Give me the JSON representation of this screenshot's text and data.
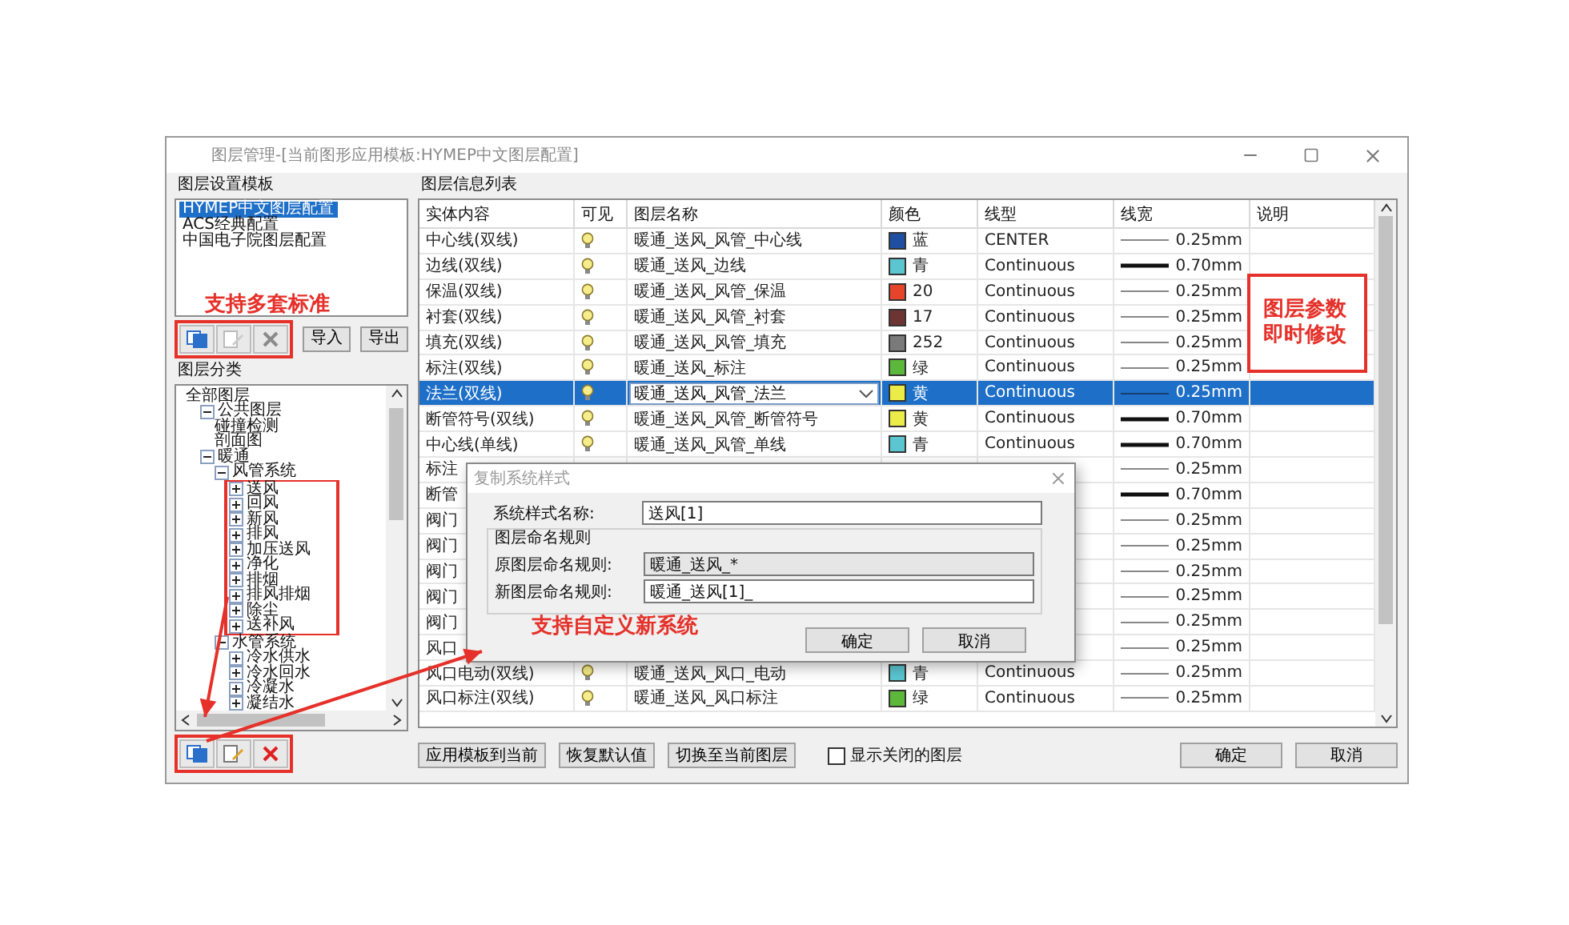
{
  "window": {
    "title": "图层管理-[当前图形应用模板:HYMEP中文图层配置]"
  },
  "templates": {
    "label": "图层设置模板",
    "items": [
      {
        "label": "HYMEP中文图层配置",
        "selected": true
      },
      {
        "label": "ACS经典配置",
        "selected": false
      },
      {
        "label": "中国电子院图层配置",
        "selected": false
      }
    ],
    "tools": [
      {
        "kind": "copy",
        "disabled": false
      },
      {
        "kind": "edit",
        "disabled": true
      },
      {
        "kind": "delete",
        "disabled": true
      }
    ],
    "buttons": [
      "导入",
      "导出"
    ]
  },
  "categories": {
    "label": "图层分类",
    "tree": [
      {
        "label": "全部图层",
        "children": [
          {
            "label": "公共图层",
            "expanded": true,
            "children": [
              {
                "label": "碰撞检测"
              },
              {
                "label": "剖面图"
              }
            ]
          },
          {
            "label": "暖通",
            "expanded": true,
            "children": [
              {
                "label": "风管系统",
                "expanded": true,
                "highlighted": true,
                "children": [
                  {
                    "label": "送风",
                    "expanded": false
                  },
                  {
                    "label": "回风",
                    "expanded": false
                  },
                  {
                    "label": "新风",
                    "expanded": false
                  },
                  {
                    "label": "排风",
                    "expanded": false
                  },
                  {
                    "label": "加压送风",
                    "expanded": false
                  },
                  {
                    "label": "净化",
                    "expanded": false
                  },
                  {
                    "label": "排烟",
                    "expanded": false
                  },
                  {
                    "label": "排风排烟",
                    "expanded": false
                  },
                  {
                    "label": "除尘",
                    "expanded": false
                  },
                  {
                    "label": "送补风",
                    "expanded": false
                  }
                ]
              },
              {
                "label": "水管系统",
                "expanded": true,
                "highlighted": false,
                "children": [
                  {
                    "label": "冷水供水",
                    "expanded": false
                  },
                  {
                    "label": "冷水回水",
                    "expanded": false
                  },
                  {
                    "label": "冷凝水",
                    "expanded": false
                  },
                  {
                    "label": "凝结水",
                    "expanded": false
                  }
                ]
              }
            ]
          }
        ]
      }
    ],
    "tools": [
      {
        "kind": "copy",
        "disabled": false
      },
      {
        "kind": "edit",
        "disabled": false
      },
      {
        "kind": "delete",
        "disabled": false
      }
    ]
  },
  "layers": {
    "label": "图层信息列表",
    "columns": [
      "实体内容",
      "可见",
      "图层名称",
      "颜色",
      "线型",
      "线宽",
      "说明"
    ],
    "rows": [
      {
        "entity": "中心线(双线)",
        "visible": true,
        "layer": "暖通_送风_风管_中心线",
        "color": "#1f4fa3",
        "color_label": "蓝",
        "linetype": "CENTER",
        "weight": {
          "kind": "thin",
          "label": "0.25mm"
        },
        "selected": false
      },
      {
        "entity": "边线(双线)",
        "visible": true,
        "layer": "暖通_送风_边线",
        "color": "#5bc6d0",
        "color_label": "青",
        "linetype": "Continuous",
        "weight": {
          "kind": "thick",
          "label": "0.70mm"
        },
        "selected": false
      },
      {
        "entity": "保温(双线)",
        "visible": true,
        "layer": "暖通_送风_风管_保温",
        "color": "#e6452c",
        "color_label": "20",
        "linetype": "Continuous",
        "weight": {
          "kind": "thin",
          "label": "0.25mm"
        },
        "selected": false
      },
      {
        "entity": "衬套(双线)",
        "visible": true,
        "layer": "暖通_送风_风管_衬套",
        "color": "#6e3434",
        "color_label": "17",
        "linetype": "Continuous",
        "weight": {
          "kind": "thin",
          "label": "0.25mm"
        },
        "selected": false
      },
      {
        "entity": "填充(双线)",
        "visible": true,
        "layer": "暖通_送风_风管_填充",
        "color": "#7a7a7a",
        "color_label": "252",
        "linetype": "Continuous",
        "weight": {
          "kind": "thin",
          "label": "0.25mm"
        },
        "selected": false
      },
      {
        "entity": "标注(双线)",
        "visible": true,
        "layer": "暖通_送风_标注",
        "color": "#5cb83a",
        "color_label": "绿",
        "linetype": "Continuous",
        "weight": {
          "kind": "thin",
          "label": "0.25mm"
        },
        "selected": false
      },
      {
        "entity": "法兰(双线)",
        "visible": true,
        "layer": "暖通_送风_风管_法兰",
        "color": "#ecec48",
        "color_label": "黄",
        "linetype": "Continuous",
        "weight": {
          "kind": "thin",
          "label": "0.25mm"
        },
        "selected": true
      },
      {
        "entity": "断管符号(双线)",
        "visible": true,
        "layer": "暖通_送风_风管_断管符号",
        "color": "#ecec48",
        "color_label": "黄",
        "linetype": "Continuous",
        "weight": {
          "kind": "thick",
          "label": "0.70mm"
        },
        "selected": false
      },
      {
        "entity": "中心线(单线)",
        "visible": true,
        "layer": "暖通_送风_风管_单线",
        "color": "#5bc6d0",
        "color_label": "青",
        "linetype": "Continuous",
        "weight": {
          "kind": "thick",
          "label": "0.70mm"
        },
        "selected": false
      },
      {
        "entity": "标注",
        "weight": {
          "kind": "thin",
          "label": "0.25mm"
        },
        "selected": false
      },
      {
        "entity": "断管",
        "weight": {
          "kind": "thick",
          "label": "0.70mm"
        },
        "selected": false
      },
      {
        "entity": "阀门",
        "weight": {
          "kind": "thin",
          "label": "0.25mm"
        },
        "selected": false
      },
      {
        "entity": "阀门",
        "weight": {
          "kind": "thin",
          "label": "0.25mm"
        },
        "selected": false
      },
      {
        "entity": "阀门",
        "weight": {
          "kind": "thin",
          "label": "0.25mm"
        },
        "selected": false
      },
      {
        "entity": "阀门",
        "weight": {
          "kind": "thin",
          "label": "0.25mm"
        },
        "selected": false
      },
      {
        "entity": "阀门",
        "weight": {
          "kind": "thin",
          "label": "0.25mm"
        },
        "selected": false
      },
      {
        "entity": "风口",
        "weight": {
          "kind": "thin",
          "label": "0.25mm"
        },
        "selected": false
      },
      {
        "entity": "风口电动(双线)",
        "visible": true,
        "layer": "暖通_送风_风口_电动",
        "color": "#5bc6d0",
        "color_label": "青",
        "linetype": "Continuous",
        "weight": {
          "kind": "thin",
          "label": "0.25mm"
        },
        "selected": false
      },
      {
        "entity": "风口标注(双线)",
        "visible": true,
        "layer": "暖通_送风_风口标注",
        "color": "#5cb83a",
        "color_label": "绿",
        "linetype": "Continuous",
        "weight": {
          "kind": "thin",
          "label": "0.25mm"
        },
        "selected": false
      }
    ]
  },
  "actions": [
    "应用模板到当前",
    "恢复默认值",
    "切换至当前图层"
  ],
  "show_closed": {
    "label": "显示关闭的图层",
    "checked": false
  },
  "buttons": [
    "确定",
    "取消"
  ],
  "dialog": {
    "title": "复制系统样式",
    "name_label": "系统样式名称:",
    "name_value": "送风[1]",
    "group_label": "图层命名规则",
    "fields": [
      {
        "label": "原图层命名规则:",
        "value": "暖通_送风_*",
        "disabled": true
      },
      {
        "label": "新图层命名规则:",
        "value": "暖通_送风[1]_",
        "disabled": false
      }
    ],
    "buttons": [
      "确定",
      "取消"
    ]
  },
  "annotations": [
    {
      "text": "支持多套标准"
    },
    {
      "text": "图层参数即时修改"
    },
    {
      "text": "支持自定义新系统"
    }
  ]
}
